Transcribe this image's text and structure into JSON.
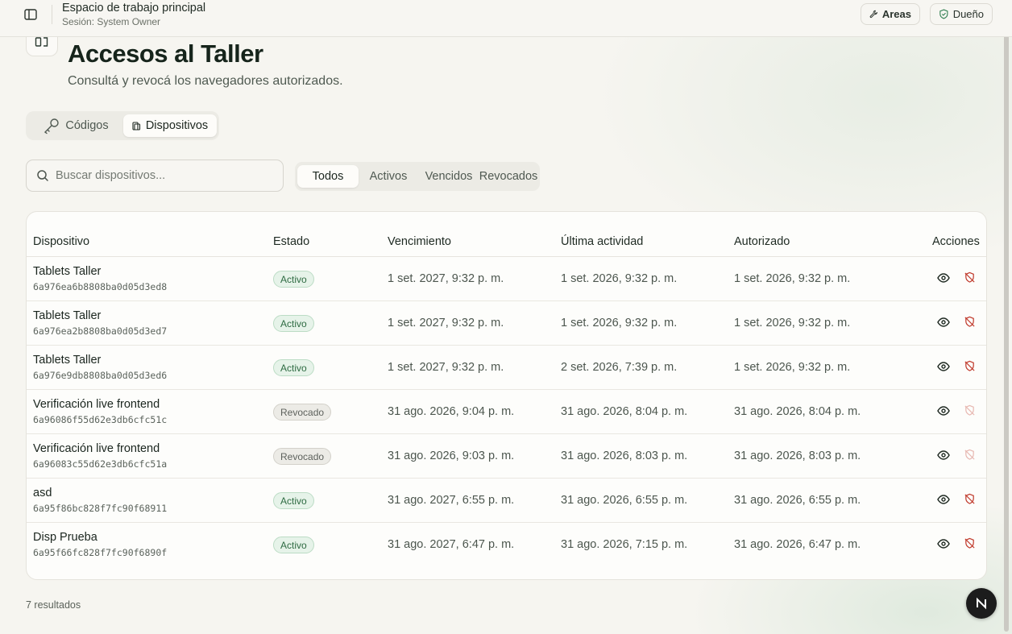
{
  "workspace": {
    "title": "Espacio de trabajo principal",
    "session": "Sesión: System Owner"
  },
  "topbar": {
    "areas_label": "Areas",
    "owner_label": "Dueño"
  },
  "page": {
    "title": "Accesos al Taller",
    "subtitle": "Consultá y revocá los navegadores autorizados."
  },
  "tabs": [
    {
      "label": "Códigos",
      "icon": "key-icon",
      "active": false
    },
    {
      "label": "Dispositivos",
      "icon": "device-icon",
      "active": true
    }
  ],
  "search": {
    "placeholder": "Buscar dispositivos...",
    "value": ""
  },
  "filters": [
    {
      "label": "Todos",
      "active": true
    },
    {
      "label": "Activos",
      "active": false
    },
    {
      "label": "Vencidos",
      "active": false
    },
    {
      "label": "Revocados",
      "active": false
    }
  ],
  "table": {
    "columns": [
      "Dispositivo",
      "Estado",
      "Vencimiento",
      "Última actividad",
      "Autorizado",
      "Acciones"
    ],
    "rows": [
      {
        "name": "Tablets Taller",
        "id": "6a976ea6b8808ba0d05d3ed8",
        "status": "Activo",
        "expires": "1 set. 2027, 9:32 p. m.",
        "last_activity": "1 set. 2026, 9:32 p. m.",
        "authorized": "1 set. 2026, 9:32 p. m."
      },
      {
        "name": "Tablets Taller",
        "id": "6a976ea2b8808ba0d05d3ed7",
        "status": "Activo",
        "expires": "1 set. 2027, 9:32 p. m.",
        "last_activity": "1 set. 2026, 9:32 p. m.",
        "authorized": "1 set. 2026, 9:32 p. m."
      },
      {
        "name": "Tablets Taller",
        "id": "6a976e9db8808ba0d05d3ed6",
        "status": "Activo",
        "expires": "1 set. 2027, 9:32 p. m.",
        "last_activity": "2 set. 2026, 7:39 p. m.",
        "authorized": "1 set. 2026, 9:32 p. m."
      },
      {
        "name": "Verificación live frontend",
        "id": "6a96086f55d62e3db6cfc51c",
        "status": "Revocado",
        "expires": "31 ago. 2026, 9:04 p. m.",
        "last_activity": "31 ago. 2026, 8:04 p. m.",
        "authorized": "31 ago. 2026, 8:04 p. m."
      },
      {
        "name": "Verificación live frontend",
        "id": "6a96083c55d62e3db6cfc51a",
        "status": "Revocado",
        "expires": "31 ago. 2026, 9:03 p. m.",
        "last_activity": "31 ago. 2026, 8:03 p. m.",
        "authorized": "31 ago. 2026, 8:03 p. m."
      },
      {
        "name": "asd",
        "id": "6a95f86bc828f7fc90f68911",
        "status": "Activo",
        "expires": "31 ago. 2027, 6:55 p. m.",
        "last_activity": "31 ago. 2026, 6:55 p. m.",
        "authorized": "31 ago. 2026, 6:55 p. m."
      },
      {
        "name": "Disp Prueba",
        "id": "6a95f66fc828f7fc90f6890f",
        "status": "Activo",
        "expires": "31 ago. 2027, 6:47 p. m.",
        "last_activity": "31 ago. 2026, 7:15 p. m.",
        "authorized": "31 ago. 2026, 6:47 p. m."
      }
    ]
  },
  "footer": {
    "results": "7 resultados"
  },
  "colors": {
    "background": "#f6f5f0",
    "active_badge": "#2e6b42",
    "revoke_icon": "#c0392b"
  }
}
